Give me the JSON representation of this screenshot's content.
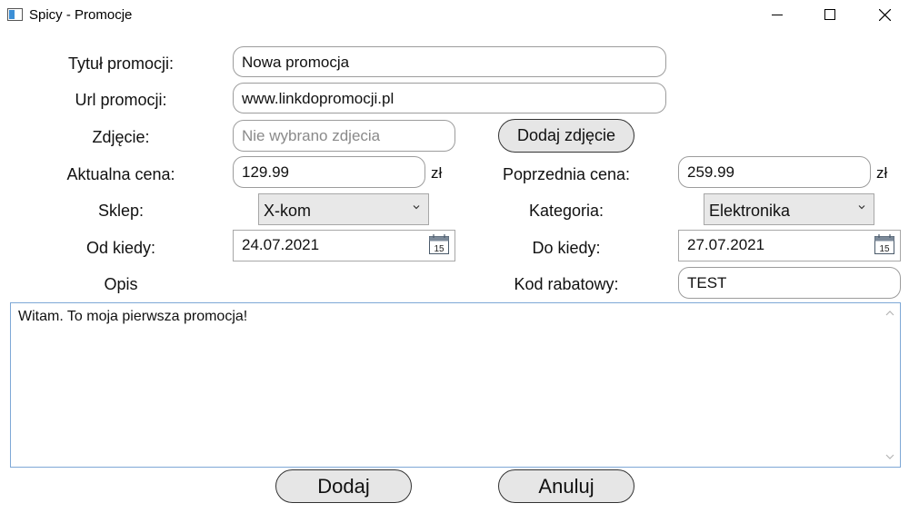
{
  "window": {
    "title": "Spicy - Promocje",
    "icon": "app-window-icon",
    "controls": [
      "minimize-icon",
      "maximize-icon",
      "close-icon"
    ]
  },
  "form": {
    "title_label": "Tytuł promocji:",
    "title_value": "Nowa promocja",
    "url_label": "Url promocji:",
    "url_value": "www.linkdopromocji.pl",
    "photo_label": "Zdjęcie:",
    "photo_placeholder": "Nie wybrano zdjecia",
    "add_photo_button": "Dodaj zdjęcie",
    "current_price_label": "Aktualna cena:",
    "current_price_value": "129.99",
    "current_price_unit": "zł",
    "previous_price_label": "Poprzednia cena:",
    "previous_price_value": "259.99",
    "previous_price_unit": "zł",
    "shop_label": "Sklep:",
    "shop_selected": "X-kom",
    "category_label": "Kategoria:",
    "category_selected": "Elektronika",
    "from_label": "Od kiedy:",
    "from_value": "24.07.2021",
    "to_label": "Do kiedy:",
    "to_value": "27.07.2021",
    "calendar_day": "15",
    "description_label": "Opis",
    "discount_code_label": "Kod rabatowy:",
    "discount_code_value": "TEST",
    "description_value": "Witam. To moja pierwsza promocja!"
  },
  "actions": {
    "add_button": "Dodaj",
    "cancel_button": "Anuluj"
  }
}
